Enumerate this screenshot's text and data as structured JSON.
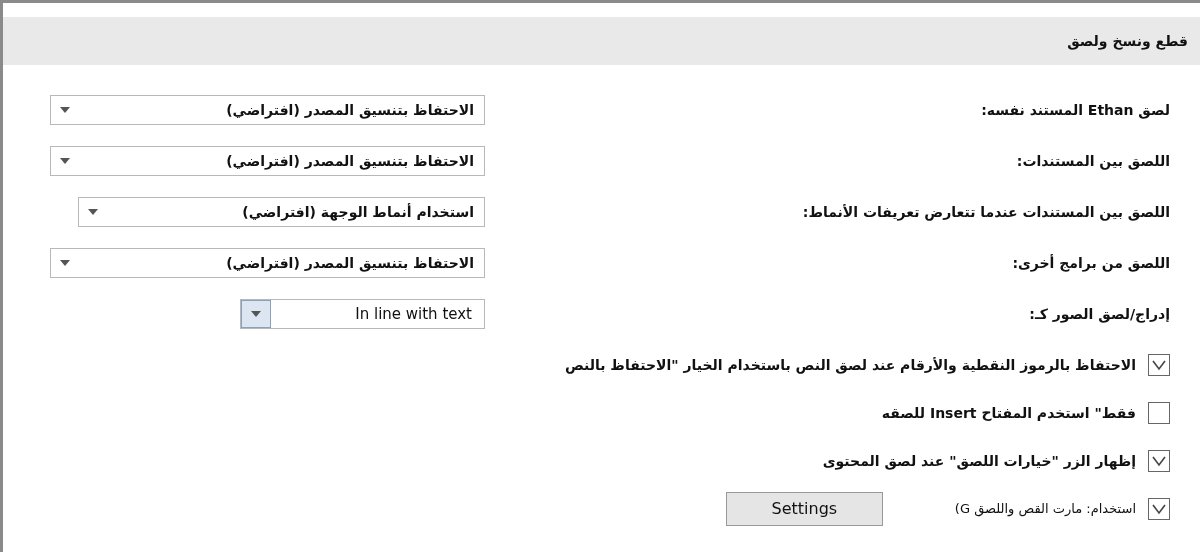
{
  "section": {
    "title": "قطع ونسخ ولصق"
  },
  "paste_options": [
    {
      "label": "لصق Ethan المستند نفسه:",
      "kind": "standard",
      "value": "الاحتفاظ بتنسيق المصدر (افتراضي)"
    },
    {
      "label": "اللصق بين المستندات:",
      "kind": "standard",
      "value": "الاحتفاظ بتنسيق المصدر (افتراضي)"
    },
    {
      "label": "اللصق بين المستندات عندما تتعارض تعريفات الأنماط:",
      "kind": "indented",
      "value": "استخدام أنماط الوجهة (افتراضي)"
    },
    {
      "label": "اللصق من برامج أخرى:",
      "kind": "standard",
      "value": "الاحتفاظ بتنسيق المصدر (افتراضي)"
    },
    {
      "label": "إدراج/لصق الصور كـ:",
      "kind": "picture",
      "value": "In line with text"
    }
  ],
  "checkboxes": [
    {
      "label": "الاحتفاظ بالرموز النقطية والأرقام عند لصق النص باستخدام الخيار \"الاحتفاظ بالنص",
      "checked": true
    },
    {
      "label": "فقط\" استخدم المفتاح Insert للصقه",
      "checked": false
    },
    {
      "label": "إظهار الزر \"خيارات اللصق\" عند لصق المحتوى",
      "checked": true
    },
    {
      "label": "استخدام: مارت القص واللصق G)",
      "checked": true,
      "button": "Settings"
    }
  ]
}
